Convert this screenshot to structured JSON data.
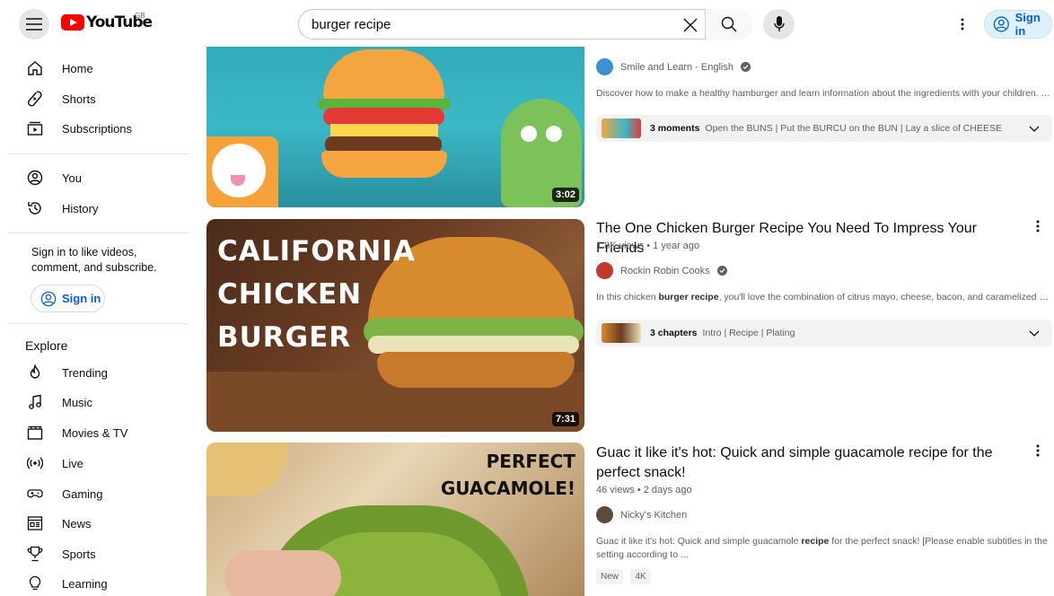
{
  "header": {
    "logo_text": "YouTube",
    "country_code": "GB",
    "search_value": "burger recipe",
    "sign_in_label": "Sign in"
  },
  "sidebar": {
    "main_items": [
      {
        "label": "Home",
        "icon": "home-icon"
      },
      {
        "label": "Shorts",
        "icon": "shorts-icon"
      },
      {
        "label": "Subscriptions",
        "icon": "subscriptions-icon"
      }
    ],
    "you_items": [
      {
        "label": "You",
        "icon": "you-icon"
      },
      {
        "label": "History",
        "icon": "history-icon"
      }
    ],
    "sign_in_note": "Sign in to like videos, comment, and subscribe.",
    "sign_in_label": "Sign in",
    "explore_heading": "Explore",
    "explore_items": [
      {
        "label": "Trending",
        "icon": "trending-icon"
      },
      {
        "label": "Music",
        "icon": "music-icon"
      },
      {
        "label": "Movies & TV",
        "icon": "movies-icon"
      },
      {
        "label": "Live",
        "icon": "live-icon"
      },
      {
        "label": "Gaming",
        "icon": "gaming-icon"
      },
      {
        "label": "News",
        "icon": "news-icon"
      },
      {
        "label": "Sports",
        "icon": "sports-icon"
      },
      {
        "label": "Learning",
        "icon": "learning-icon"
      }
    ]
  },
  "results": [
    {
      "duration": "3:02",
      "channel": "Smile and Learn - English",
      "verified": true,
      "description": "Discover how to make a healthy hamburger and learn information about the ingredients with your children. This ...",
      "chapters_count": "3 moments",
      "chapters_list": "Open the BUNS | Put the BURCU on the BUN | Lay a slice of CHEESE"
    },
    {
      "duration": "7:31",
      "thumb_text": [
        "CALIFORNIA",
        "CHICKEN",
        "BURGER"
      ],
      "title": "The One Chicken Burger Recipe You Need To Impress Your Friends",
      "meta": "1.8K views • 1 year ago",
      "channel": "Rockin Robin Cooks",
      "verified": true,
      "description_pre": "In this chicken ",
      "description_bold": "burger recipe",
      "description_post": ", you'll love the combination of citrus mayo, cheese, bacon, and caramelized onion. ...",
      "chapters_count": "3 chapters",
      "chapters_list": "Intro | Recipe | Plating"
    },
    {
      "thumb_text": [
        "PERFECT",
        "GUACAMOLE!"
      ],
      "title": "Guac it like it's hot: Quick and simple guacamole recipe for the perfect snack!",
      "meta": "46 views • 2 days ago",
      "channel": "Nicky's Kitchen",
      "description_pre": "Guac it like it's hot: Quick and simple guacamole ",
      "description_bold": "recipe",
      "description_post": " for the perfect snack! [Please enable subtitles in the setting according to ...",
      "badges": [
        "New",
        "4K"
      ]
    }
  ]
}
